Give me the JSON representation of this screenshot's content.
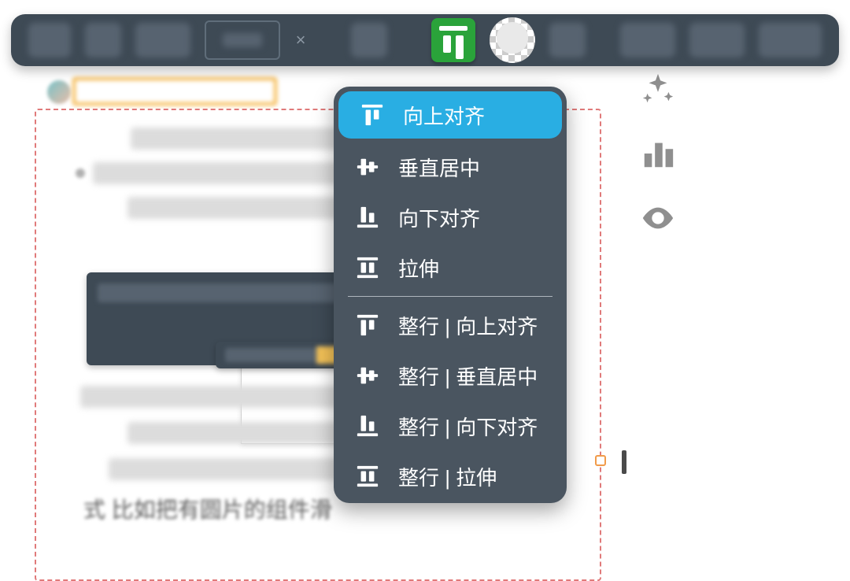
{
  "toolbar": {
    "align_button_name": "vertical-align-top"
  },
  "menu": {
    "items_top": [
      {
        "id": "align-top",
        "label": "向上对齐",
        "icon": "align-top",
        "selected": true
      },
      {
        "id": "align-middle",
        "label": "垂直居中",
        "icon": "align-middle",
        "selected": false
      },
      {
        "id": "align-bottom",
        "label": "向下对齐",
        "icon": "align-bottom",
        "selected": false
      },
      {
        "id": "stretch",
        "label": "拉伸",
        "icon": "stretch",
        "selected": false
      }
    ],
    "items_bottom": [
      {
        "id": "row-align-top",
        "label": "整行 | 向上对齐",
        "icon": "align-top"
      },
      {
        "id": "row-align-middle",
        "label": "整行 | 垂直居中",
        "icon": "align-middle"
      },
      {
        "id": "row-align-bottom",
        "label": "整行 | 向下对齐",
        "icon": "align-bottom"
      },
      {
        "id": "row-stretch",
        "label": "整行 | 拉伸",
        "icon": "stretch"
      }
    ]
  },
  "side_icons": [
    "sparkle-icon",
    "bar-chart-icon",
    "eye-icon"
  ],
  "bg_text": {
    "line1": "式  比如把有圆片的组件滑"
  }
}
